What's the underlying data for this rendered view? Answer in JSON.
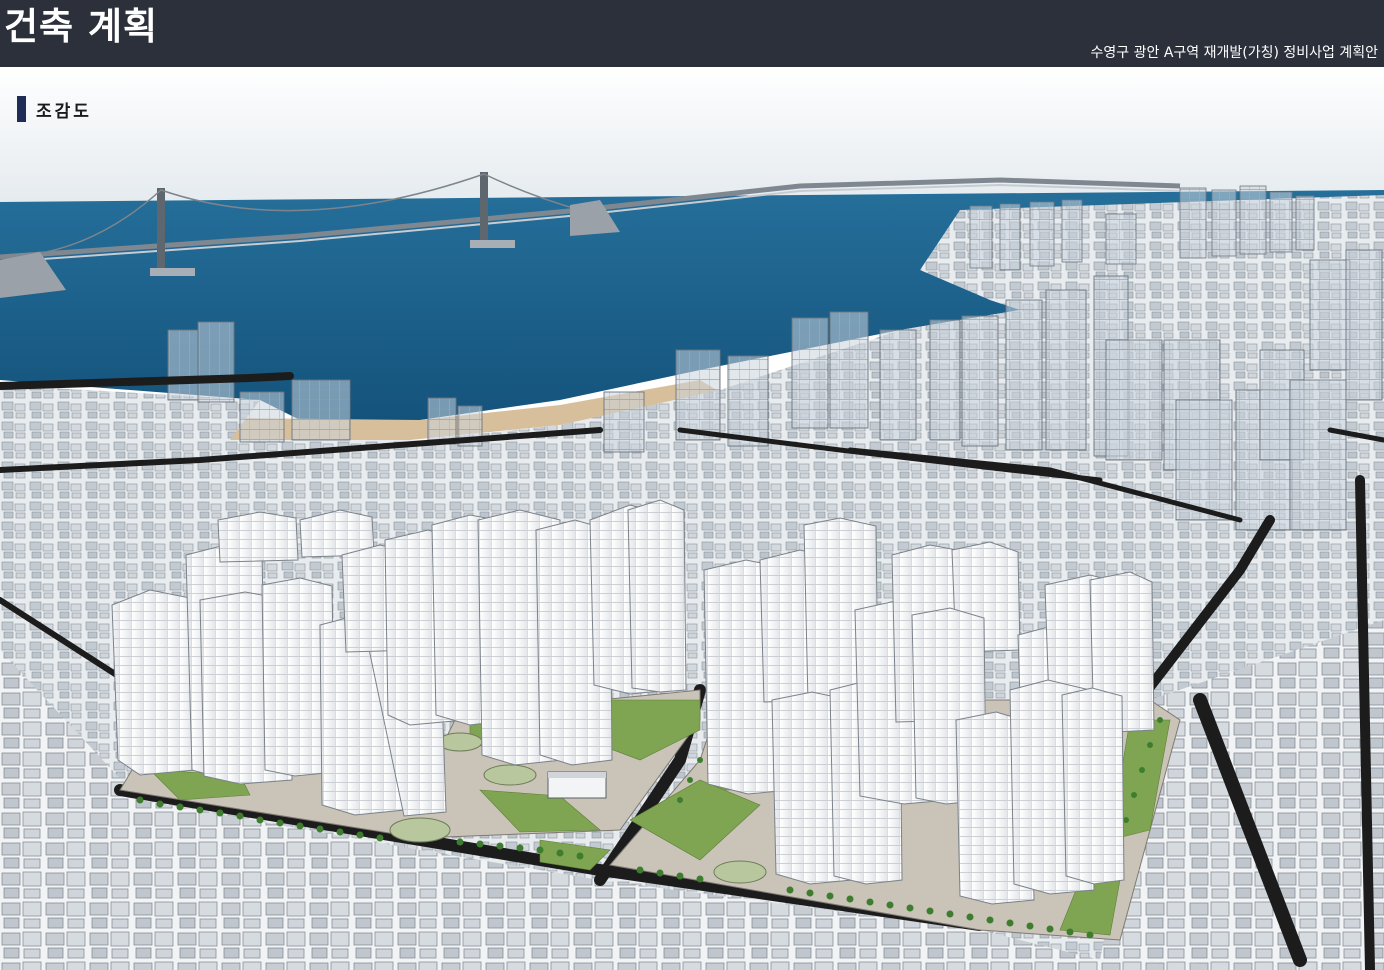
{
  "header": {
    "title": "건축 계획",
    "subtitle": "수영구 광안 A구역 재개발(가칭) 정비사업 계획안"
  },
  "section": {
    "label": "조감도"
  },
  "colors": {
    "header_bg": "#2b303b",
    "header_text": "#ffffff",
    "section_marker": "#1f2c56",
    "sea": "#1b5d86",
    "sky": "#eef2f5",
    "beach": "#d8bf9c",
    "green": "#7fa552",
    "road": "#1c1c1c"
  },
  "illustration": {
    "type": "aerial-perspective-rendering"
  }
}
